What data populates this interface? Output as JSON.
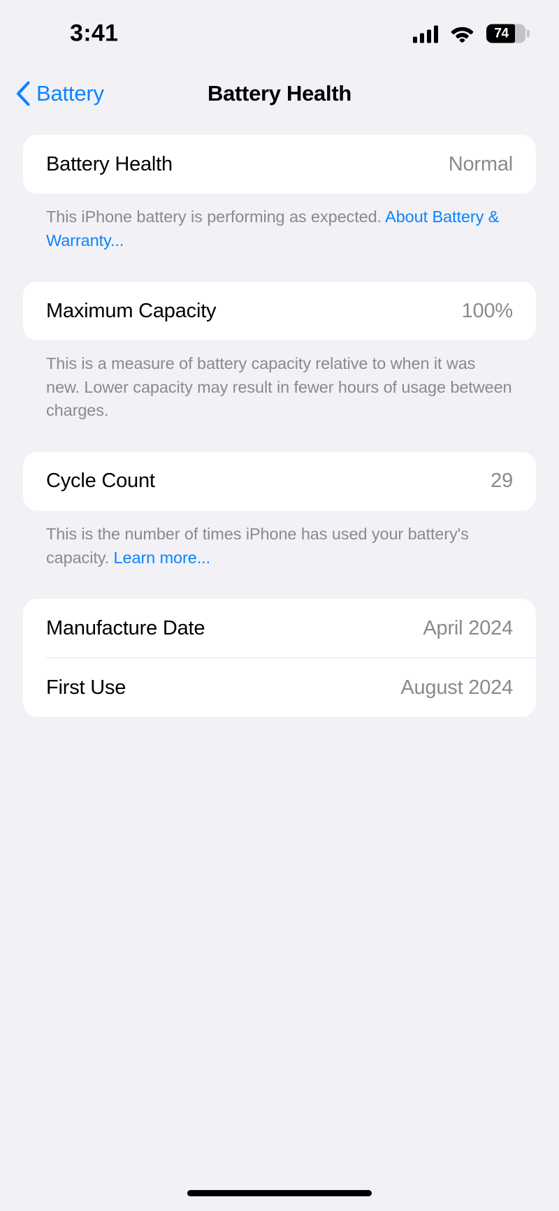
{
  "status_bar": {
    "time": "3:41",
    "signal_icon": "cellular-bars-icon",
    "wifi_icon": "wifi-icon",
    "battery_icon": "battery-icon",
    "battery_percent": "74",
    "battery_level": 74
  },
  "nav": {
    "back_icon": "chevron-left-icon",
    "back_label": "Battery",
    "title": "Battery Health"
  },
  "sections": [
    {
      "rows": [
        {
          "label": "Battery Health",
          "value": "Normal"
        }
      ],
      "footnote": {
        "text": "This iPhone battery is performing as expected. ",
        "link": "About Battery & Warranty..."
      }
    },
    {
      "rows": [
        {
          "label": "Maximum Capacity",
          "value": "100%"
        }
      ],
      "footnote": {
        "text": "This is a measure of battery capacity relative to when it was new. Lower capacity may result in fewer hours of usage between charges.",
        "link": ""
      }
    },
    {
      "rows": [
        {
          "label": "Cycle Count",
          "value": "29"
        }
      ],
      "footnote": {
        "text": "This is the number of times iPhone has used your battery's capacity. ",
        "link": "Learn more..."
      }
    },
    {
      "rows": [
        {
          "label": "Manufacture Date",
          "value": "April 2024"
        },
        {
          "label": "First Use",
          "value": "August 2024"
        }
      ],
      "footnote": {
        "text": "",
        "link": ""
      }
    }
  ],
  "colors": {
    "accent_blue": "#0a84ff",
    "background": "#f1f1f6",
    "card": "#ffffff",
    "secondary_text": "#8a8a8e"
  },
  "home_indicator": "home-indicator"
}
